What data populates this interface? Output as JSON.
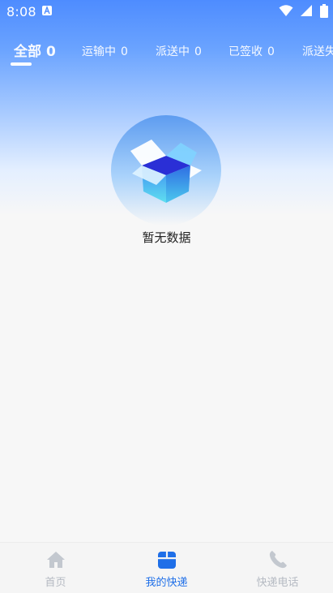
{
  "status_bar": {
    "time": "8:08"
  },
  "tabs": [
    {
      "label": "全部",
      "count": "0",
      "active": true
    },
    {
      "label": "运输中",
      "count": "0",
      "active": false
    },
    {
      "label": "派送中",
      "count": "0",
      "active": false
    },
    {
      "label": "已签收",
      "count": "0",
      "active": false
    },
    {
      "label": "派送失败",
      "count": "",
      "active": false
    }
  ],
  "empty_state": {
    "text": "暂无数据"
  },
  "bottom_nav": [
    {
      "label": "首页",
      "icon": "home-icon",
      "active": false
    },
    {
      "label": "我的快递",
      "icon": "package-icon",
      "active": true
    },
    {
      "label": "快递电话",
      "icon": "phone-icon",
      "active": false
    }
  ],
  "colors": {
    "accent": "#1f6fe8",
    "header_blue": "#4e8cff",
    "inactive_nav": "#b5bac2"
  }
}
